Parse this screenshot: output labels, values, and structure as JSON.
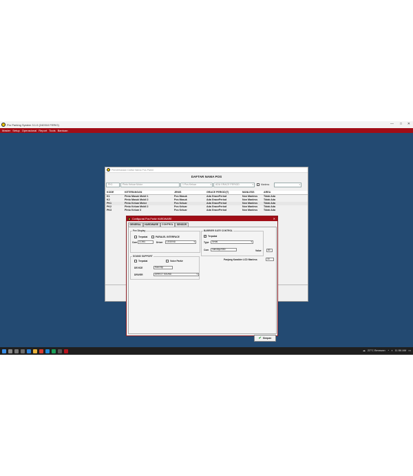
{
  "app": {
    "title": "Pro Parking System 3.1.0 (240310 FERIO)",
    "window_controls": [
      "—",
      "□",
      "✕"
    ],
    "menu": [
      "Master",
      "Setup",
      "Operasional",
      "Report",
      "Tools",
      "Bantuan"
    ]
  },
  "daftar": {
    "window_title": "Pemeliharaan Daftar Nama Pos Parkir",
    "heading": "DAFTAR NAMA POS",
    "filters": {
      "kode": "PK1",
      "keterangan": "Pintu Keluar Motor",
      "jenis": "1 Pos Keluar",
      "grace": "ADA GRACE PERIOD",
      "manless_label": "Manless",
      "area": ""
    },
    "columns": [
      "KODE",
      "KETERANGAN",
      "JENIS",
      "GRACE PERIOD(T)",
      "MANLESS",
      "AREA"
    ],
    "rows": [
      [
        "K1",
        "Pintu Masuk Mobil 1",
        "Pos Masuk",
        "Ada GracePeriod",
        "Non Manless",
        "Tidak Ada"
      ],
      [
        "K2",
        "Pintu Masuk Mobil 2",
        "Pos Masuk",
        "Ada GracePeriod",
        "Non Manless",
        "Tidak Ada"
      ],
      [
        "PK1",
        "Pintu Keluar Motor",
        "Pos Keluar",
        "Ada GracePeriod",
        "Non Manless",
        "Tidak Ada"
      ],
      [
        "PK2",
        "Pintu Keluar Mobil 2",
        "Pos Keluar",
        "Ada GracePeriod",
        "Non Manless",
        "Tidak Ada"
      ],
      [
        "PK3",
        "Pintu Keluar 3",
        "Pos Keluar",
        "Ada GracePeriod",
        "Non Manless",
        "Tidak Ada"
      ]
    ]
  },
  "config": {
    "window_title": "Configurasi Pos Parkir HARDWARE",
    "tabs": [
      "GENERAL",
      "HARDWARE",
      "CONTROL",
      "SENSOR"
    ],
    "active_tab": "CONTROL",
    "fee_display": {
      "title": "Fee Display",
      "terpakai": "Terpakai",
      "paralel": "PARALEL INTERFACE",
      "com_label": "Com",
      "com_value": "COM1",
      "driver_label": "Driver",
      "driver_value": "LEGEND"
    },
    "barrier": {
      "title": "BARRIER GATE CONTROL",
      "terpakai": "Terpakai",
      "terpakai_checked": true,
      "type_label": "Type",
      "type_value": "Serial",
      "com_label": "Com",
      "com_value": "\\\\dev\\ttyUSB0",
      "value_label": "Value",
      "value": "83"
    },
    "lcd": {
      "label": "Panjang Karakter LCD Manless",
      "value": "16"
    },
    "sound": {
      "title": "SOUND SUPPORT",
      "terpakai": "Terpakai",
      "voice_parkir": "Voice Parkir",
      "device_label": "DEVICE",
      "device_value": "Hard Mp",
      "driver_label": "DRIVER",
      "driver_value": "DIRECT SOUND"
    },
    "save_label": "Simpan"
  },
  "taskbar": {
    "weather": "22°C Berawan",
    "time": "11:56 AM"
  },
  "colors": {
    "menubar": "#a10d16",
    "desktop": "#234a72",
    "taskbar": "#1f1f1f"
  }
}
